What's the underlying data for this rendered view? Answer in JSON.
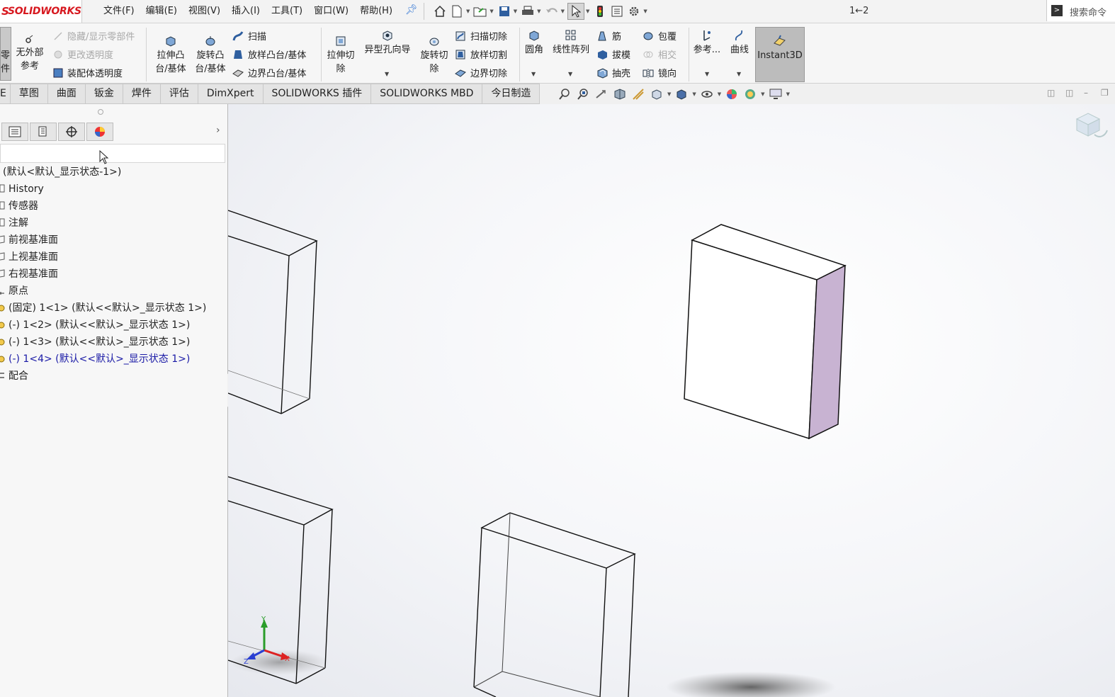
{
  "app": {
    "logo_prefix": "DS",
    "logo_name": "SOLIDWORKS"
  },
  "menu": [
    "文件(F)",
    "编辑(E)",
    "视图(V)",
    "插入(I)",
    "工具(T)",
    "窗口(W)",
    "帮助(H)"
  ],
  "page_counter": "1←2",
  "search": {
    "placeholder": "搜索命令"
  },
  "ribbon": {
    "left_partial": [
      "零",
      "件"
    ],
    "no_external_ref": [
      "无外部",
      "参考"
    ],
    "hide_show": "隐藏/显示零部件",
    "change_transparency": "更改透明度",
    "assembly_transparency": "装配体透明度",
    "extrude_boss": [
      "拉伸凸",
      "台/基体"
    ],
    "revolve_boss": [
      "旋转凸",
      "台/基体"
    ],
    "sweep": "扫描",
    "loft_boss": "放样凸台/基体",
    "boundary_boss": "边界凸台/基体",
    "extrude_cut": [
      "拉伸切",
      "除"
    ],
    "hole_wizard": "异型孔向导",
    "revolve_cut": [
      "旋转切",
      "除"
    ],
    "swept_cut": "扫描切除",
    "lofted_cut": "放样切割",
    "boundary_cut": "边界切除",
    "fillet": "圆角",
    "linear_pattern": "线性阵列",
    "rib": "筋",
    "draft": "拔模",
    "shell": "抽壳",
    "wrap": "包覆",
    "intersect": "相交",
    "mirror": "镜向",
    "reference": "参考...",
    "curves": "曲线",
    "instant3d": "Instant3D"
  },
  "tabs": [
    "E",
    "草图",
    "曲面",
    "钣金",
    "焊件",
    "评估",
    "DimXpert",
    "SOLIDWORKS 插件",
    "SOLIDWORKS MBD",
    "今日制造"
  ],
  "tree": {
    "root": "(默认<默认_显示状态-1>)",
    "items": [
      {
        "label": "History",
        "style": "normal"
      },
      {
        "label": "传感器",
        "style": "normal"
      },
      {
        "label": "注解",
        "style": "normal"
      },
      {
        "label": "前视基准面",
        "style": "normal"
      },
      {
        "label": "上视基准面",
        "style": "normal"
      },
      {
        "label": "右视基准面",
        "style": "normal"
      },
      {
        "label": "原点",
        "style": "normal"
      },
      {
        "label": "(固定) 1<1> (默认<<默认>_显示状态 1>)",
        "style": "normal"
      },
      {
        "label": "(-) 1<2> (默认<<默认>_显示状态 1>)",
        "style": "normal"
      },
      {
        "label": "(-) 1<3> (默认<<默认>_显示状态 1>)",
        "style": "normal"
      },
      {
        "label": "(-) 1<4> (默认<<默认>_显示状态 1>)",
        "style": "selected-blue"
      },
      {
        "label": "配合",
        "style": "normal"
      }
    ]
  },
  "triad": {
    "x": "X",
    "y": "Y",
    "z": "Z"
  },
  "colors": {
    "accent_blue": "#1a1aa6",
    "brand_red": "#d71920",
    "face_side": "#c8b3d2",
    "instant3d_bg": "#bcbcbc"
  }
}
